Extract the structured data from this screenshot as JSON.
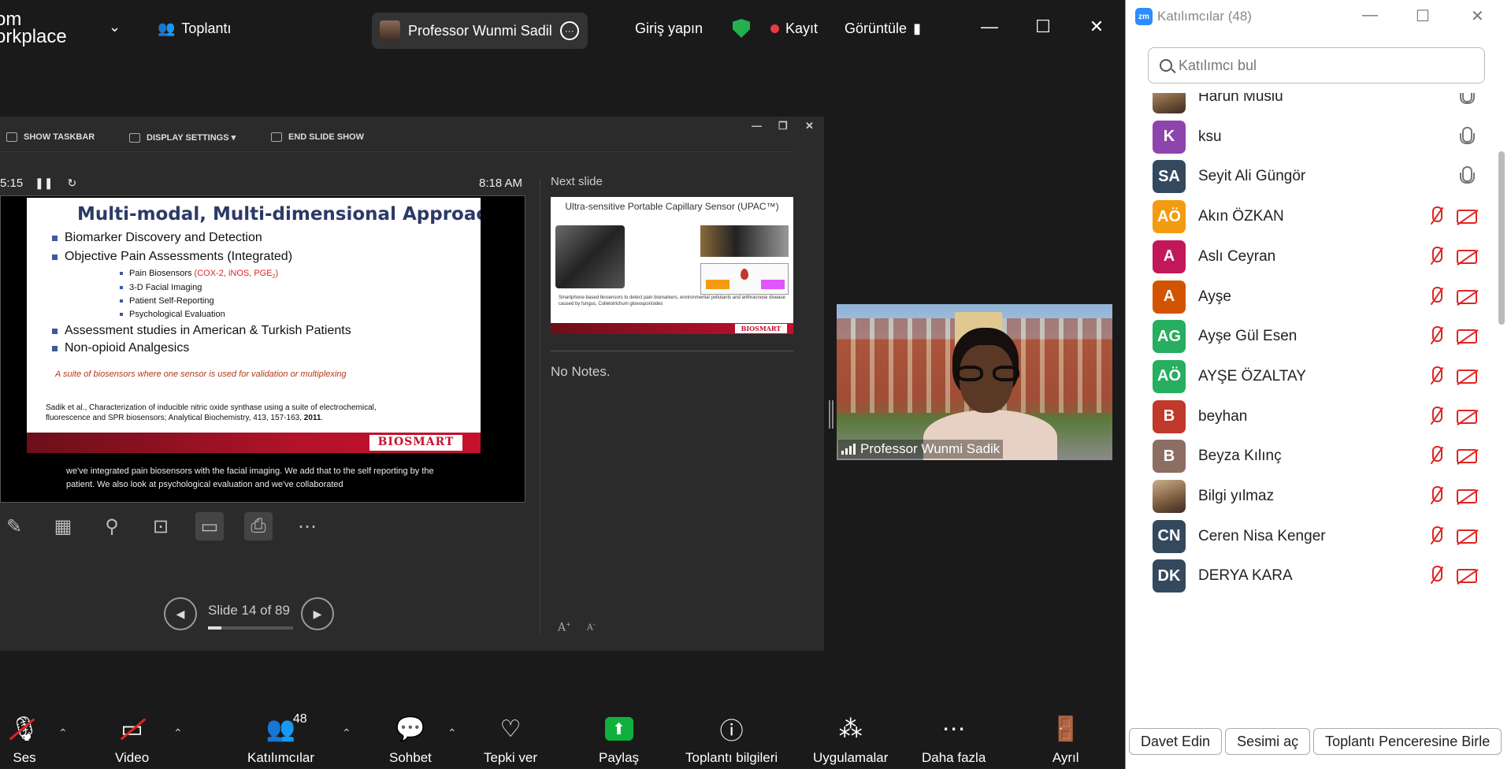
{
  "app": {
    "brand_line1": "om",
    "brand_line2": "orkplace",
    "meeting_label": "Toplantı",
    "presenter_pill": "Professor Wunmi Sadil",
    "sign_in": "Giriş yapın",
    "record": "Kayıt",
    "view": "Görüntüle"
  },
  "powerpoint": {
    "toolbar": {
      "show_taskbar": "SHOW TASKBAR",
      "display_settings": "DISPLAY SETTINGS ▾",
      "end_show": "END SLIDE SHOW"
    },
    "timer": "5:15",
    "clock": "8:18 AM",
    "current_slide": {
      "title": "Multi-modal, Multi-dimensional Approach",
      "bullet1": "Biomarker Discovery and Detection",
      "bullet2": "Objective Pain Assessments (Integrated)",
      "sub1_prefix": "Pain Biosensors ",
      "sub1_red": "(COX-2, iNOS, PGE",
      "sub1_sub": "2",
      "sub1_end": ")",
      "sub2": "3-D Facial Imaging",
      "sub3": "Patient Self-Reporting",
      "sub4": "Psychological Evaluation",
      "bullet3": "Assessment studies in American & Turkish Patients",
      "bullet4": "Non-opioid Analgesics",
      "note": "A suite of biosensors where one sensor is used for validation or multiplexing",
      "citation": "Sadik et al., Characterization of inducible nitric oxide synthase using a suite of electrochemical, fluorescence and SPR biosensors; Analytical Biochemistry, 413, 157-163, ",
      "citation_year": "2011",
      "logo": "BIOSMART"
    },
    "subtitle": "we've integrated pain biosensors with the facial imaging. We add that to the self reporting by the patient. We also look at psychological evaluation and we've collaborated",
    "slide_counter": "Slide 14 of 89",
    "slide_progress": 0.157,
    "next_label": "Next slide",
    "next_slide": {
      "title": "Ultra-sensitive Portable Capillary Sensor (UPAC™)",
      "caption": "Smartphone-based biosensors to detect pain biomarkers, environmental pollutants and anthracnose disease caused by fungus, Colletotrichum gloeosporioides",
      "logo": "BIOSMART"
    },
    "notes": "No Notes."
  },
  "video": {
    "name": "Professor Wunmi Sadik"
  },
  "bottombar": {
    "audio": "Ses",
    "video": "Video",
    "participants": "Katılımcılar",
    "participants_count": "48",
    "chat": "Sohbet",
    "react": "Tepki ver",
    "share": "Paylaş",
    "info": "Toplantı bilgileri",
    "apps": "Uygulamalar",
    "more": "Daha fazla",
    "leave": "Ayrıl"
  },
  "panel": {
    "title": "Katılımcılar (48)",
    "search_placeholder": "Katılımcı bul",
    "participants": [
      {
        "name": "Harun Muslu",
        "initials": "",
        "color": "",
        "photo": true,
        "muted": false,
        "video_off": false
      },
      {
        "name": "ksu",
        "initials": "K",
        "color": "#8e44ad",
        "photo": false,
        "muted": false,
        "video_off": false
      },
      {
        "name": "Seyit Ali Güngör",
        "initials": "SA",
        "color": "#34495e",
        "photo": false,
        "muted": false,
        "video_off": false
      },
      {
        "name": "Akın ÖZKAN",
        "initials": "AÖ",
        "color": "#f39c12",
        "photo": false,
        "muted": true,
        "video_off": true
      },
      {
        "name": "Aslı Ceyran",
        "initials": "A",
        "color": "#c2185b",
        "photo": false,
        "muted": true,
        "video_off": true
      },
      {
        "name": "Ayşe",
        "initials": "A",
        "color": "#d35400",
        "photo": false,
        "muted": true,
        "video_off": true
      },
      {
        "name": "Ayşe Gül Esen",
        "initials": "AG",
        "color": "#27ae60",
        "photo": false,
        "muted": true,
        "video_off": true
      },
      {
        "name": "AYŞE ÖZALTAY",
        "initials": "AÖ",
        "color": "#27ae60",
        "photo": false,
        "muted": true,
        "video_off": true
      },
      {
        "name": "beyhan",
        "initials": "B",
        "color": "#c0392b",
        "photo": false,
        "muted": true,
        "video_off": true
      },
      {
        "name": "Beyza Kılınç",
        "initials": "B",
        "color": "#8d6e63",
        "photo": false,
        "muted": true,
        "video_off": true
      },
      {
        "name": "Bilgi yılmaz",
        "initials": "",
        "color": "",
        "photo": true,
        "muted": true,
        "video_off": true
      },
      {
        "name": "Ceren Nisa Kenger",
        "initials": "CN",
        "color": "#34495e",
        "photo": false,
        "muted": true,
        "video_off": true
      },
      {
        "name": "DERYA  KARA",
        "initials": "DK",
        "color": "#34495e",
        "photo": false,
        "muted": true,
        "video_off": true
      }
    ],
    "invite": "Davet Edin",
    "unmute": "Sesimi aç",
    "meeting_window": "Toplantı Penceresine Birle"
  },
  "colors": {
    "share_green": "#0fb13c",
    "record_red": "#e63946",
    "zoom_blue": "#2d8cff"
  }
}
